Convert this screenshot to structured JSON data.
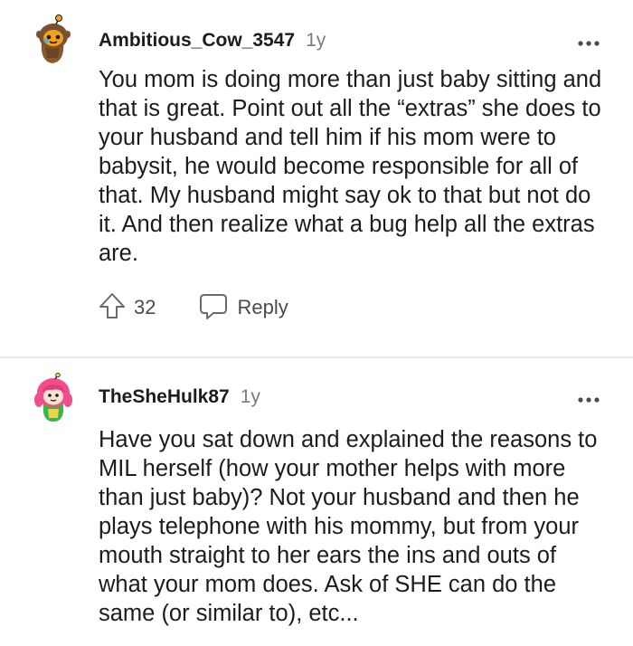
{
  "comments": [
    {
      "username": "Ambitious_Cow_3547",
      "age": "1y",
      "avatar_icon": "snoo-avatar-orange-pumpkin",
      "text": "You mom is doing more than just baby sitting and that is great. Point out all the “extras” she does to your husband and tell him if his mom were to babysit, he would become responsible for all of that. My husband might say ok to that but not do it. And then realize what a bug help all the extras are.",
      "upvotes": "32",
      "reply_label": "Reply"
    },
    {
      "username": "TheSheHulk87",
      "age": "1y",
      "avatar_icon": "snoo-avatar-pink-hair",
      "text": "Have you sat down and explained the reasons to MIL herself (how your mother helps with more than just baby)? Not your husband and then he plays telephone with his mommy, but from your mouth straight to her ears the ins and outs of what your mom does. Ask of SHE can do the same (or similar to), etc..."
    }
  ],
  "colors": {
    "text": "#1c1c1c",
    "meta": "#787c7e",
    "action": "#4a4a4a",
    "divider": "#e7e7e7"
  }
}
